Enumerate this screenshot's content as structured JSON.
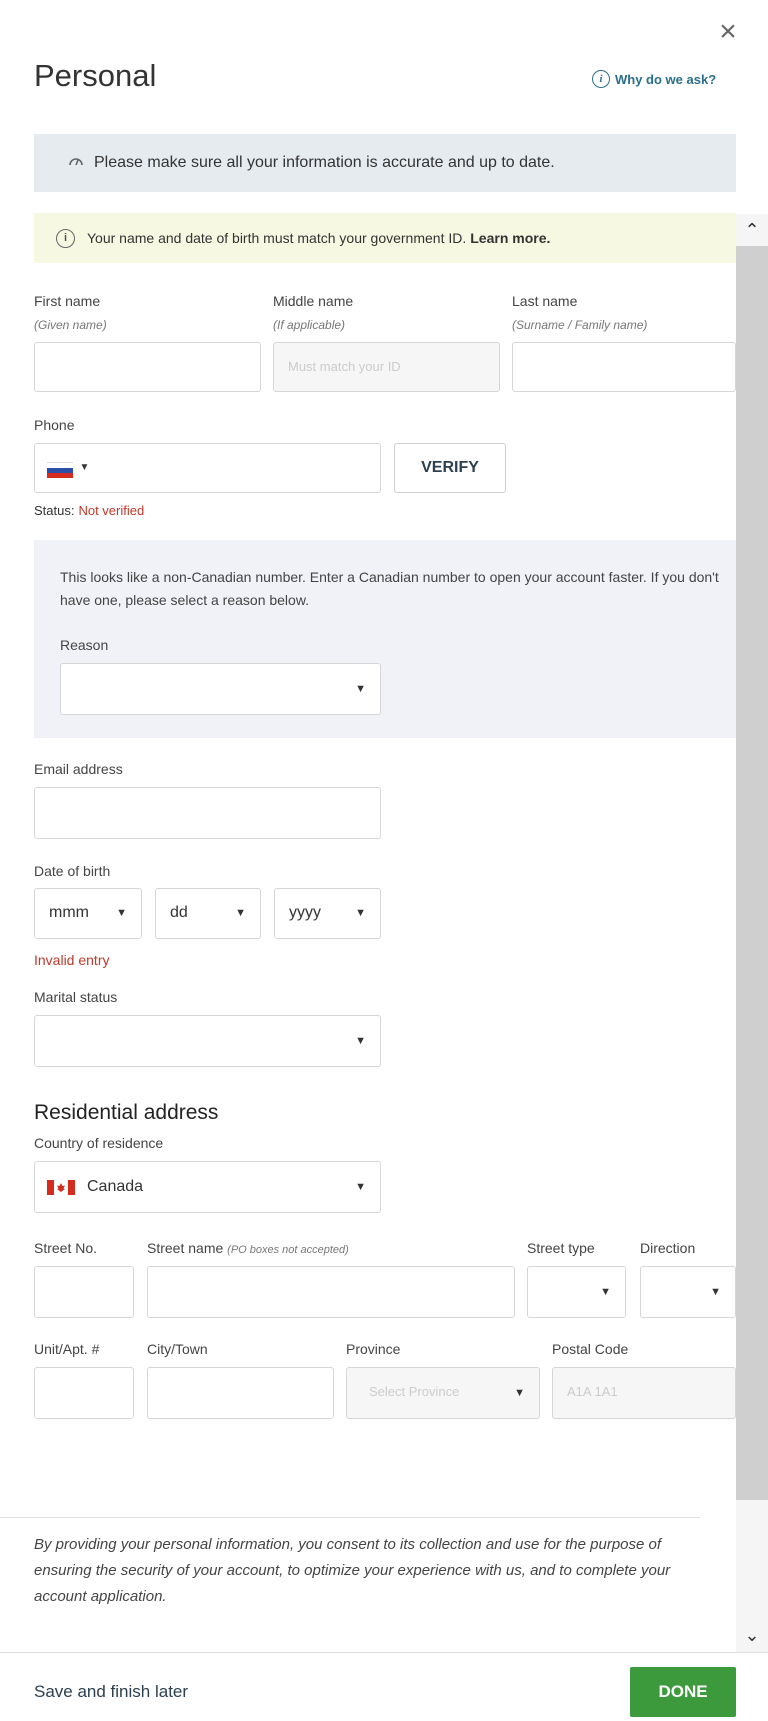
{
  "header": {
    "title": "Personal",
    "why_label": "Why do we ask?"
  },
  "banner": {
    "accurate_text": "Please make sure all your information is accurate and up to date."
  },
  "notice": {
    "text": "Your name and date of birth must match your government ID.",
    "link": "Learn more."
  },
  "name_fields": {
    "first_label": "First name",
    "first_sub": "(Given name)",
    "middle_label": "Middle name",
    "middle_sub": "(If applicable)",
    "middle_placeholder": "Must match your ID",
    "last_label": "Last name",
    "last_sub": "(Surname / Family name)"
  },
  "phone": {
    "label": "Phone",
    "verify_label": "VERIFY",
    "status_label": "Status:",
    "status_value": "Not verified",
    "flag": "russia-flag"
  },
  "non_canadian": {
    "text": "This looks like a non-Canadian number. Enter a Canadian number to open your account faster. If you don't have one, please select a reason below.",
    "reason_label": "Reason"
  },
  "email": {
    "label": "Email address"
  },
  "dob": {
    "label": "Date of birth",
    "month": "mmm",
    "day": "dd",
    "year": "yyyy",
    "error": "Invalid entry"
  },
  "marital": {
    "label": "Marital status"
  },
  "address": {
    "heading": "Residential address",
    "country_label": "Country of residence",
    "country_value": "Canada",
    "country_flag": "canada-flag",
    "street_no_label": "Street No.",
    "street_name_label": "Street name",
    "street_name_sub": "(PO boxes not accepted)",
    "street_type_label": "Street type",
    "direction_label": "Direction",
    "unit_label": "Unit/Apt. #",
    "city_label": "City/Town",
    "province_label": "Province",
    "province_placeholder": "Select Province",
    "postal_label": "Postal Code",
    "postal_placeholder": "A1A 1A1"
  },
  "consent": {
    "text": "By providing your personal information, you consent to its collection and use for the purpose of ensuring the security of your account, to optimize your experience with us, and to complete your account application."
  },
  "footer": {
    "save_later": "Save and finish later",
    "done": "DONE"
  },
  "colors": {
    "accent_green": "#3c9a3c",
    "error_red": "#c0392b",
    "link_blue": "#2a6f8c",
    "notice_bg": "#f7f8e2",
    "banner_bg": "#e6ebf0"
  }
}
